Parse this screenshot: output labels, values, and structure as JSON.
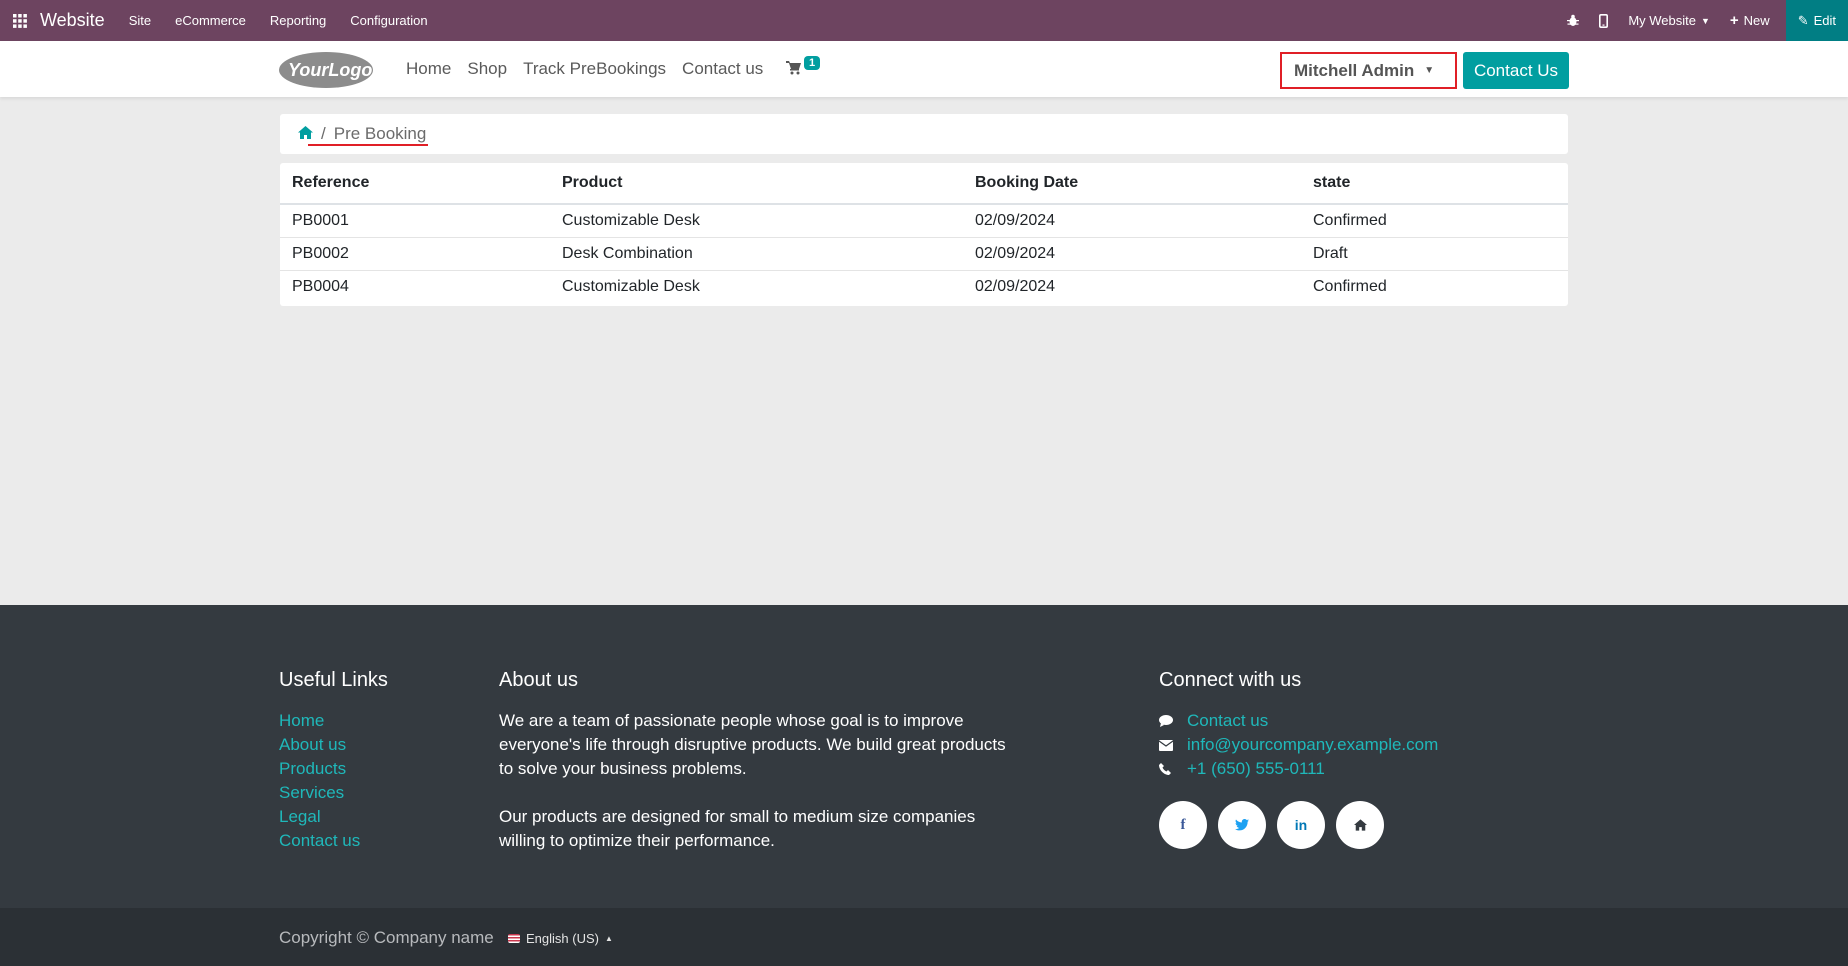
{
  "adminbar": {
    "brand": "Website",
    "menus": [
      "Site",
      "eCommerce",
      "Reporting",
      "Configuration"
    ],
    "website_selector": "My Website",
    "new_label": "New",
    "edit_label": "Edit"
  },
  "header": {
    "logo_text": "YourLogo",
    "nav": [
      "Home",
      "Shop",
      "Track PreBookings",
      "Contact us"
    ],
    "cart_count": "1",
    "user_name": "Mitchell Admin",
    "contact_button": "Contact Us"
  },
  "breadcrumb": {
    "current": "Pre Booking"
  },
  "table": {
    "columns": [
      "Reference",
      "Product",
      "Booking Date",
      "state"
    ],
    "rows": [
      [
        "PB0001",
        "Customizable Desk",
        "02/09/2024",
        "Confirmed"
      ],
      [
        "PB0002",
        "Desk Combination",
        "02/09/2024",
        "Draft"
      ],
      [
        "PB0004",
        "Customizable Desk",
        "02/09/2024",
        "Confirmed"
      ]
    ]
  },
  "footer": {
    "useful_links_title": "Useful Links",
    "useful_links": [
      "Home",
      "About us",
      "Products",
      "Services",
      "Legal",
      "Contact us"
    ],
    "about_title": "About us",
    "about_p1": "We are a team of passionate people whose goal is to improve everyone's life through disruptive products. We build great products to solve your business problems.",
    "about_p2": "Our products are designed for small to medium size companies willing to optimize their performance.",
    "connect_title": "Connect with us",
    "contact_link": "Contact us",
    "email": "info@yourcompany.example.com",
    "phone": "+1 (650) 555-0111",
    "social_icons": [
      "facebook-icon",
      "twitter-icon",
      "linkedin-icon",
      "home-icon"
    ]
  },
  "copyright": {
    "text": "Copyright © Company name",
    "language": "English (US)"
  },
  "colors": {
    "admin_bar": "#6d4460",
    "accent": "#019ea0",
    "footer": "#343a40",
    "highlight": "#e01f26"
  }
}
